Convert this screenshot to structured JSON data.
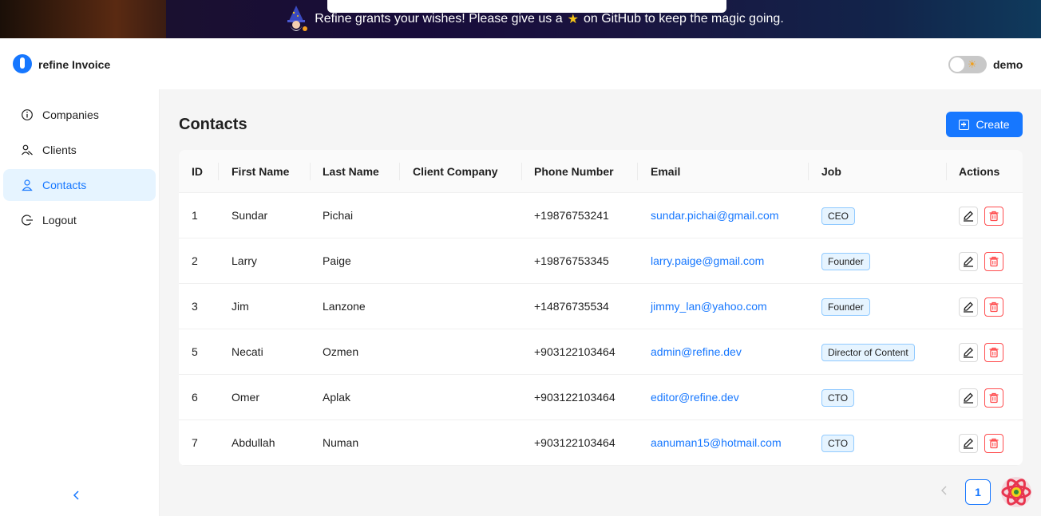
{
  "banner": {
    "text_before": "Refine grants your wishes! Please give us a",
    "text_after": "on GitHub to keep the magic going."
  },
  "header": {
    "app_title": "refine Invoice",
    "user_name": "demo"
  },
  "sidebar": {
    "items": [
      {
        "label": "Companies",
        "icon": "info-circle-icon"
      },
      {
        "label": "Clients",
        "icon": "users-icon"
      },
      {
        "label": "Contacts",
        "icon": "user-icon",
        "active": true
      },
      {
        "label": "Logout",
        "icon": "logout-icon"
      }
    ]
  },
  "page": {
    "title": "Contacts",
    "create_label": "Create"
  },
  "table": {
    "columns": [
      "ID",
      "First Name",
      "Last Name",
      "Client Company",
      "Phone Number",
      "Email",
      "Job",
      "Actions"
    ],
    "rows": [
      {
        "id": "1",
        "first": "Sundar",
        "last": "Pichai",
        "company": "",
        "phone": "+19876753241",
        "email": "sundar.pichai@gmail.com",
        "job": "CEO"
      },
      {
        "id": "2",
        "first": "Larry",
        "last": "Paige",
        "company": "",
        "phone": "+19876753345",
        "email": "larry.paige@gmail.com",
        "job": "Founder"
      },
      {
        "id": "3",
        "first": "Jim",
        "last": "Lanzone",
        "company": "",
        "phone": "+14876735534",
        "email": "jimmy_lan@yahoo.com",
        "job": "Founder"
      },
      {
        "id": "5",
        "first": "Necati",
        "last": "Ozmen",
        "company": "",
        "phone": "+903122103464",
        "email": "admin@refine.dev",
        "job": "Director of Content"
      },
      {
        "id": "6",
        "first": "Omer",
        "last": "Aplak",
        "company": "",
        "phone": "+903122103464",
        "email": "editor@refine.dev",
        "job": "CTO"
      },
      {
        "id": "7",
        "first": "Abdullah",
        "last": "Numan",
        "company": "",
        "phone": "+903122103464",
        "email": "aanuman15@hotmail.com",
        "job": "CTO"
      }
    ]
  },
  "pagination": {
    "current_page": "1"
  },
  "colors": {
    "primary": "#1677ff",
    "danger": "#ff4d4f",
    "tag_bg": "#e6f4ff"
  }
}
